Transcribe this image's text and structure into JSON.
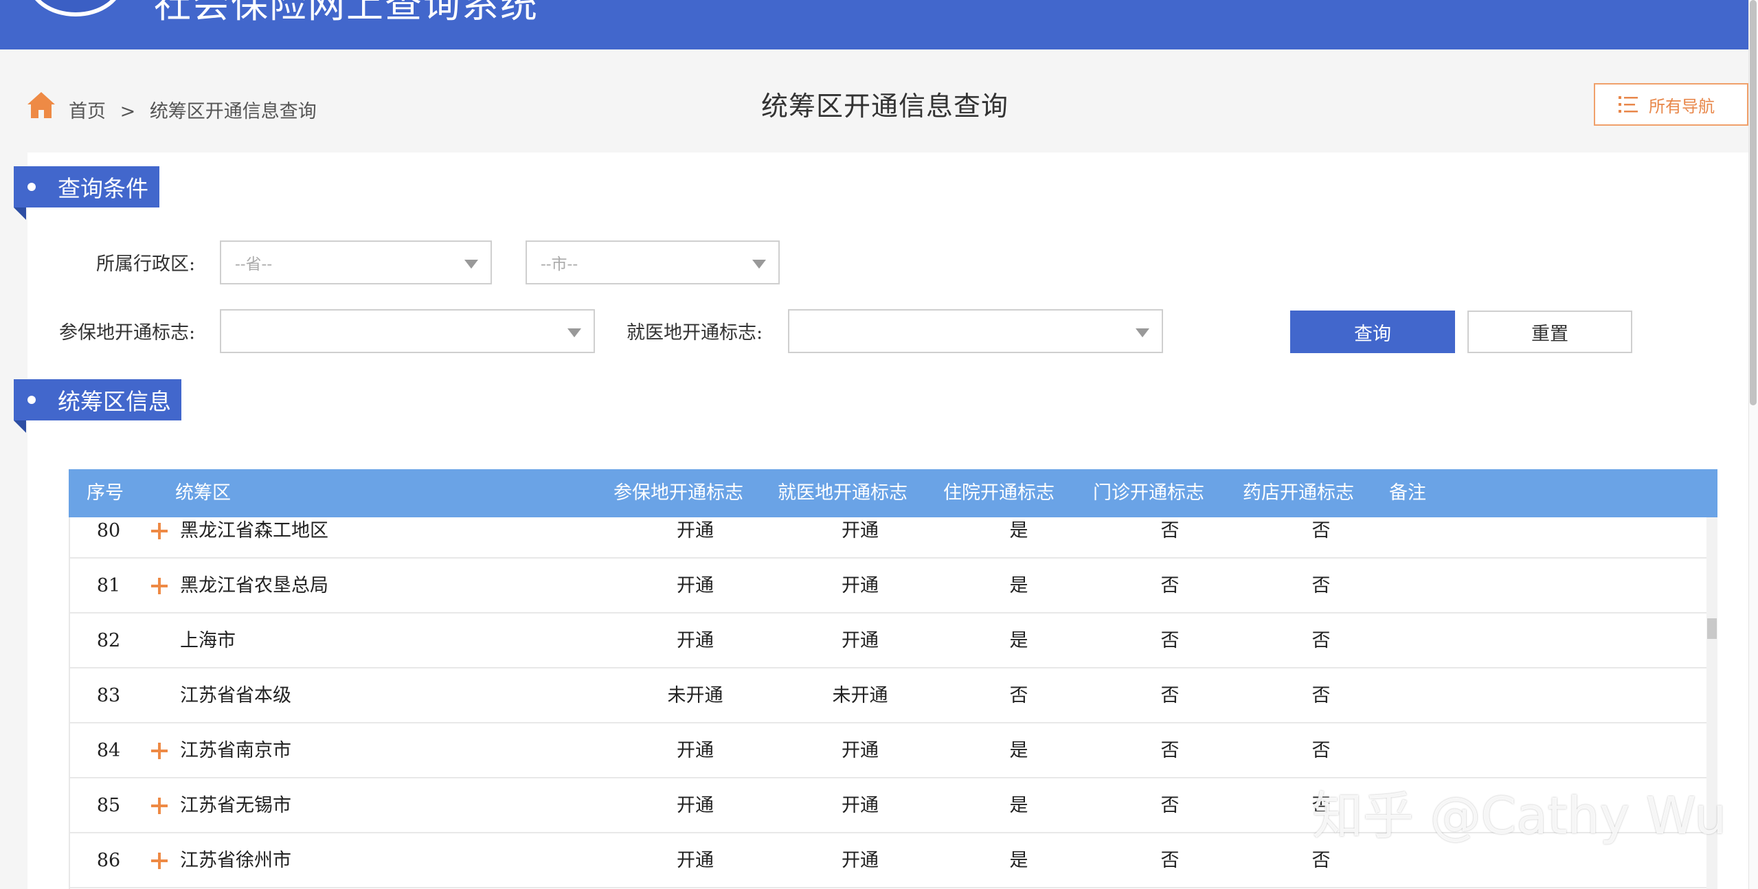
{
  "header": {
    "site_title": "社会保险网上查询系统"
  },
  "breadcrumb": {
    "home": "首页",
    "separator": ">",
    "current": "统筹区开通信息查询"
  },
  "page_title": "统筹区开通信息查询",
  "nav_button": "所有导航",
  "query_section": {
    "title": "查询条件",
    "region_label": "所属行政区:",
    "province_placeholder": "--省--",
    "city_placeholder": "--市--",
    "insured_label": "参保地开通标志:",
    "medical_label": "就医地开通标志:",
    "insured_value": "",
    "medical_value": "",
    "query_button": "查询",
    "reset_button": "重置"
  },
  "info_section": {
    "title": "统筹区信息"
  },
  "table": {
    "columns": [
      "序号",
      "统筹区",
      "参保地开通标志",
      "就医地开通标志",
      "住院开通标志",
      "门诊开通标志",
      "药店开通标志",
      "备注"
    ],
    "rows": [
      {
        "num": "80",
        "name": "黑龙江省森工地区",
        "insured": "开通",
        "medical": "开通",
        "inpatient": "是",
        "outpatient": "否",
        "pharmacy": "否",
        "expandable": true
      },
      {
        "num": "81",
        "name": "黑龙江省农垦总局",
        "insured": "开通",
        "medical": "开通",
        "inpatient": "是",
        "outpatient": "否",
        "pharmacy": "否",
        "expandable": true
      },
      {
        "num": "82",
        "name": "上海市",
        "insured": "开通",
        "medical": "开通",
        "inpatient": "是",
        "outpatient": "否",
        "pharmacy": "否",
        "expandable": false
      },
      {
        "num": "83",
        "name": "江苏省省本级",
        "insured": "未开通",
        "medical": "未开通",
        "inpatient": "否",
        "outpatient": "否",
        "pharmacy": "否",
        "expandable": false
      },
      {
        "num": "84",
        "name": "江苏省南京市",
        "insured": "开通",
        "medical": "开通",
        "inpatient": "是",
        "outpatient": "否",
        "pharmacy": "否",
        "expandable": true
      },
      {
        "num": "85",
        "name": "江苏省无锡市",
        "insured": "开通",
        "medical": "开通",
        "inpatient": "是",
        "outpatient": "否",
        "pharmacy": "否",
        "expandable": true
      },
      {
        "num": "86",
        "name": "江苏省徐州市",
        "insured": "开通",
        "medical": "开通",
        "inpatient": "是",
        "outpatient": "否",
        "pharmacy": "否",
        "expandable": true
      }
    ]
  },
  "watermark": "知乎 @Cathy Wu",
  "colors": {
    "header_blue": "#4267cc",
    "table_head": "#6aa3e6",
    "accent_orange": "#ee8a45"
  }
}
